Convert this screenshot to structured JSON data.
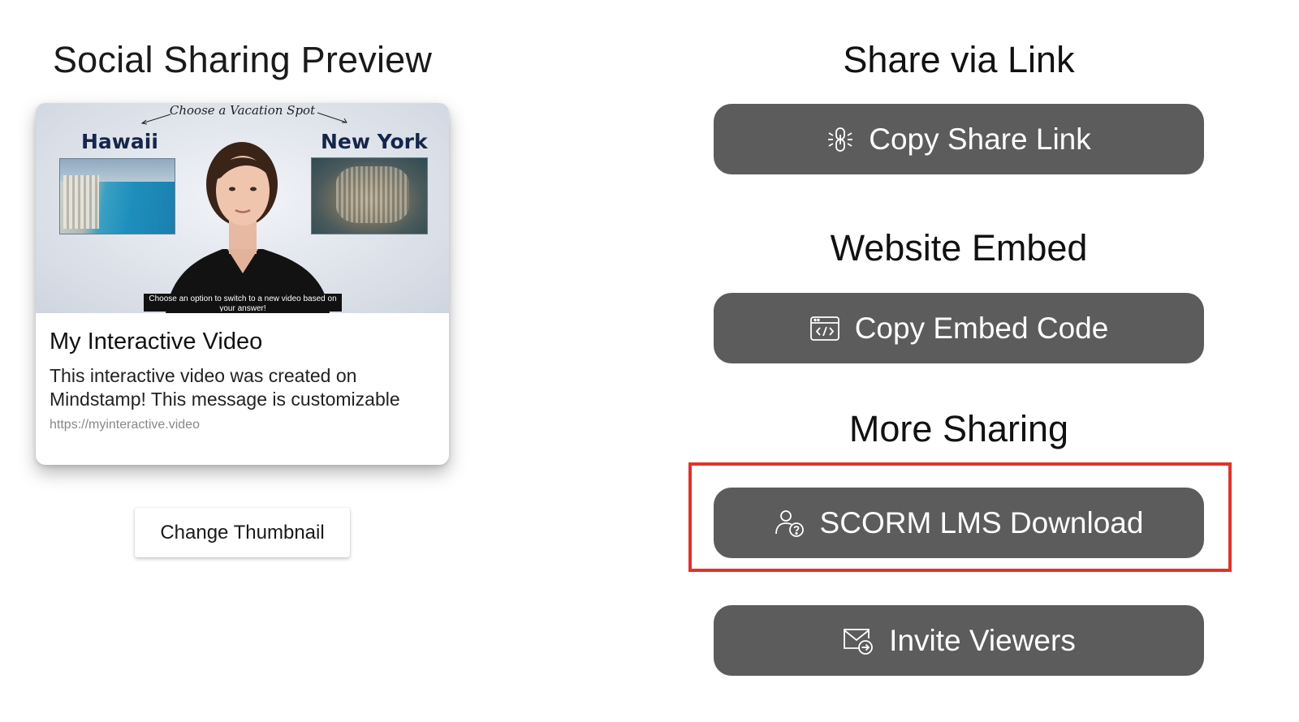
{
  "social_preview": {
    "title": "Social Sharing Preview",
    "thumbnail": {
      "header": "Choose a Vacation Spot",
      "option_left": "Hawaii",
      "option_right": "New York",
      "subtitle": "Choose an option to switch to a new video based on your answer!"
    },
    "card_title": "My Interactive Video",
    "card_description": "This interactive video was created on Mindstamp! This message is customizable",
    "card_url": "https://myinteractive.video",
    "change_thumbnail_label": "Change Thumbnail"
  },
  "share_link": {
    "title": "Share via Link",
    "button_label": "Copy Share Link",
    "icon": "link-icon"
  },
  "website_embed": {
    "title": "Website Embed",
    "button_label": "Copy Embed Code",
    "icon": "embed-code-icon"
  },
  "more_sharing": {
    "title": "More Sharing",
    "scorm_label": "SCORM LMS Download",
    "scorm_icon": "user-question-icon",
    "invite_label": "Invite Viewers",
    "invite_icon": "mail-arrow-icon"
  },
  "colors": {
    "button_bg": "#5c5c5c",
    "highlight": "#e0332a"
  }
}
